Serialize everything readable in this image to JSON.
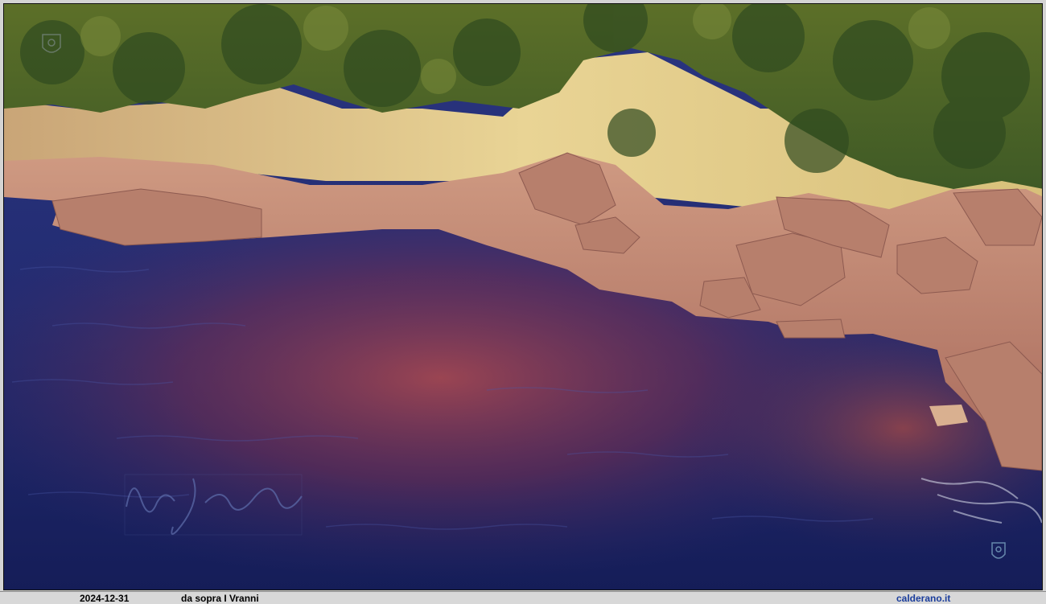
{
  "caption": {
    "date": "2024-12-31",
    "title": "da sopra I Vranni",
    "site": "calderano.it"
  },
  "photo": {
    "subject": "aerial view of rocky coastline at sunset",
    "watermarks": [
      "signature",
      "emblem-top-left",
      "emblem-bottom-right"
    ]
  },
  "colors": {
    "sea_deep": "#1b2466",
    "sea_reflection": "#8a3a4a",
    "rock": "#c98a6e",
    "cliff_lit": "#e8d79a",
    "vegetation": "#4f6a2a",
    "site_link": "#1a3d9c"
  }
}
